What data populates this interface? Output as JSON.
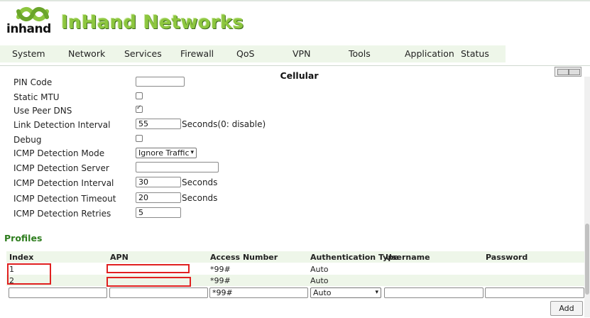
{
  "brand": {
    "logo_text": "inhand",
    "title": "InHand Networks"
  },
  "nav": {
    "items": [
      "System",
      "Network",
      "Services",
      "Firewall",
      "QoS",
      "VPN",
      "Tools",
      "Application",
      "Status"
    ]
  },
  "panel": {
    "title": "Cellular"
  },
  "form": {
    "pin_code_label": "PIN Code",
    "static_mtu_label": "Static MTU",
    "use_peer_dns_label": "Use Peer DNS",
    "use_peer_dns_checked": true,
    "link_detection_interval_label": "Link Detection Interval",
    "link_detection_interval_value": "55",
    "link_detection_interval_suffix": "Seconds(0: disable)",
    "debug_label": "Debug",
    "icmp_mode_label": "ICMP Detection Mode",
    "icmp_mode_value": "Ignore Traffic",
    "icmp_server_label": "ICMP Detection Server",
    "icmp_server_value": "",
    "icmp_interval_label": "ICMP Detection Interval",
    "icmp_interval_value": "30",
    "icmp_interval_suffix": "Seconds",
    "icmp_timeout_label": "ICMP Detection Timeout",
    "icmp_timeout_value": "20",
    "icmp_timeout_suffix": "Seconds",
    "icmp_retries_label": "ICMP Detection Retries",
    "icmp_retries_value": "5"
  },
  "profiles": {
    "title": "Profiles",
    "columns": [
      "Index",
      "APN",
      "Access Number",
      "Authentication Type",
      "Username",
      "Password"
    ],
    "rows": [
      {
        "index": "1",
        "apn": "",
        "access_number": "*99#",
        "auth": "Auto",
        "username": "",
        "password": ""
      },
      {
        "index": "2",
        "apn": "",
        "access_number": "*99#",
        "auth": "Auto",
        "username": "",
        "password": ""
      }
    ],
    "new_row": {
      "access_number": "*99#",
      "auth": "Auto"
    },
    "add_label": "Add"
  },
  "colors": {
    "brand_green": "#8dc63f",
    "section_green": "#2e7d1e",
    "nav_bg": "#eef6e9",
    "highlight_red": "#e02020"
  }
}
